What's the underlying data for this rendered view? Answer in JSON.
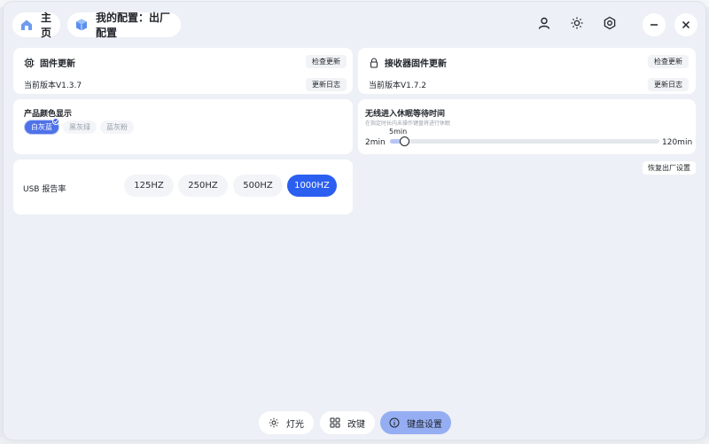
{
  "header": {
    "home_label": "主页",
    "config_label": "我的配置：出厂配置",
    "buttons": [
      "user-icon",
      "brightness-icon",
      "settings-hex-icon",
      "minimize-icon",
      "close-icon"
    ]
  },
  "firmware": {
    "title": "固件更新",
    "check_label": "检查更新",
    "version": "当前版本V1.3.7",
    "changelog_label": "更新日志"
  },
  "receiver": {
    "title": "接收器固件更新",
    "check_label": "检查更新",
    "version": "当前版本V1.7.2",
    "changelog_label": "更新日志"
  },
  "color": {
    "title": "产品颜色显示",
    "options": [
      "白灰蓝",
      "黑灰绿",
      "蓝灰粉"
    ],
    "selected_index": 0
  },
  "sleep": {
    "title": "无线进入休眠等待时间",
    "subtitle": "在指定时长内未操作键盘将进行休眠",
    "min_label": "2min",
    "max_label": "120min",
    "value_label": "5min",
    "min": 2,
    "max": 120,
    "value": 5
  },
  "restore_label": "恢复出厂设置",
  "usb": {
    "title": "USB 报告率",
    "options": [
      "125HZ",
      "250HZ",
      "500HZ",
      "1000HZ"
    ],
    "selected_index": 3
  },
  "tabs": [
    {
      "label": "灯光",
      "icon": "sun-icon",
      "active": false
    },
    {
      "label": "改键",
      "icon": "grid-icon",
      "active": false
    },
    {
      "label": "键盘设置",
      "icon": "info-icon",
      "active": true
    }
  ],
  "colors": {
    "accent": "#2b5ff0",
    "accent_soft": "#95aef3",
    "background": "#edf0f6"
  }
}
